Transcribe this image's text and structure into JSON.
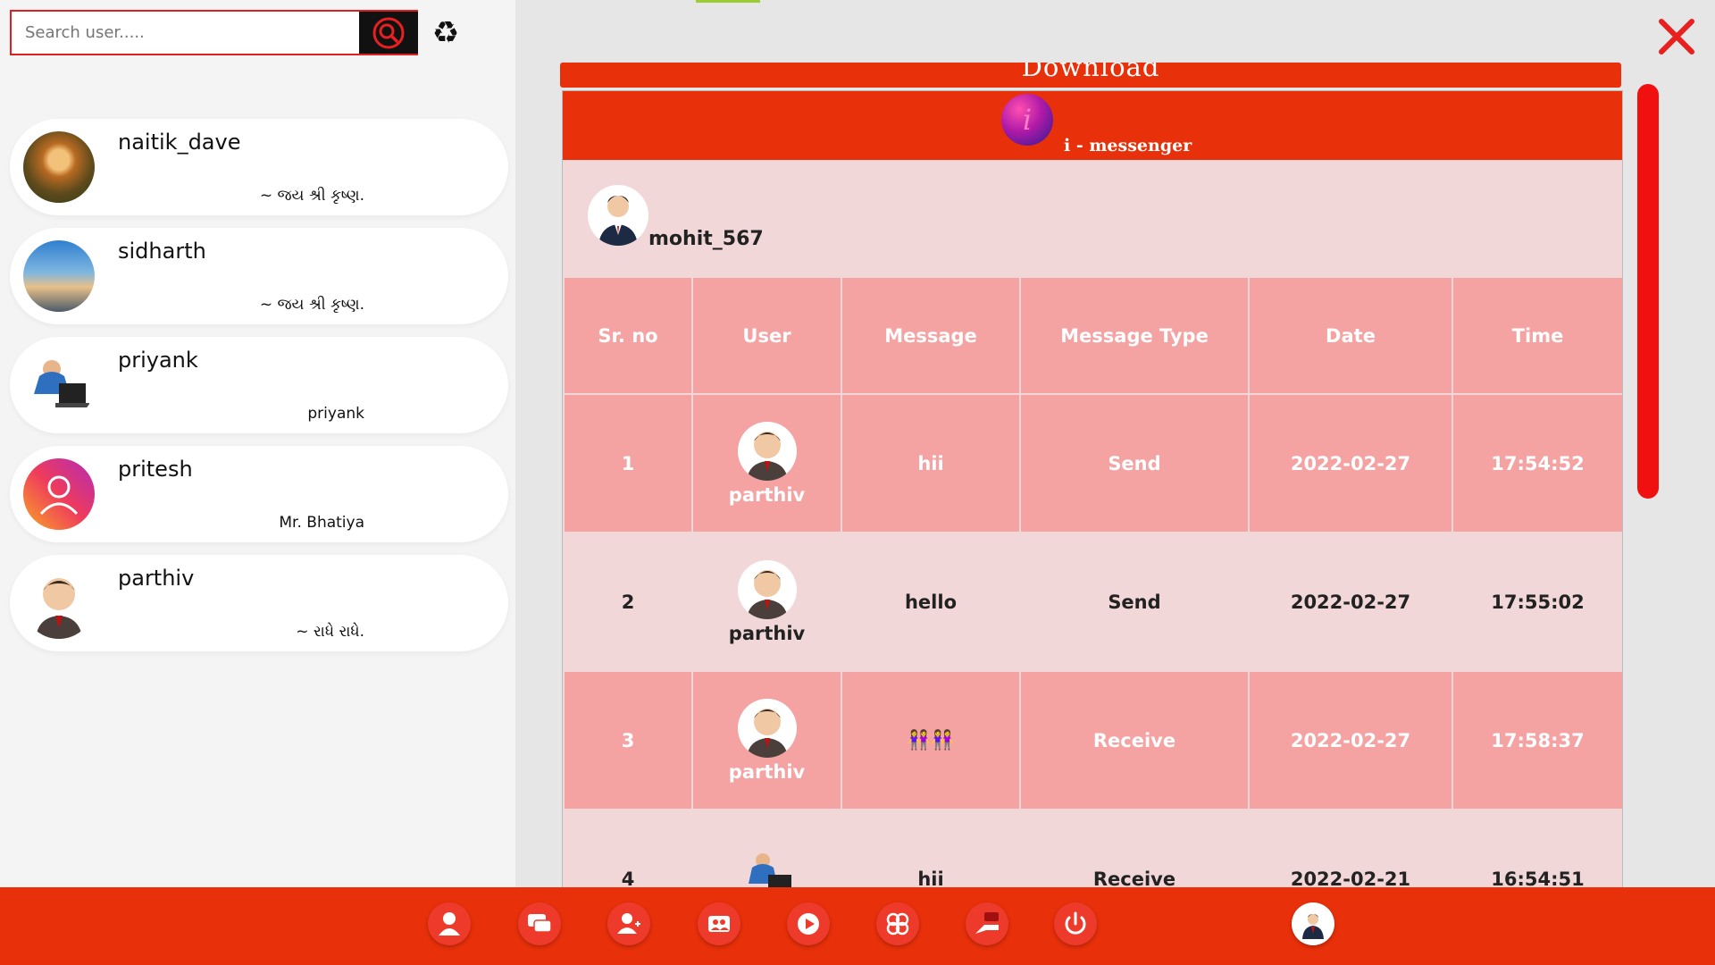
{
  "search": {
    "placeholder": "Search user....."
  },
  "contacts": [
    {
      "name": "naitik_dave",
      "status": "~ જય શ્રી કૃષ્ણ."
    },
    {
      "name": "sidharth",
      "status": "~ જય શ્રી કૃષ્ણ."
    },
    {
      "name": "priyank",
      "status": "priyank"
    },
    {
      "name": "pritesh",
      "status": "Mr. Bhatiya"
    },
    {
      "name": "parthiv",
      "status": "~ રાધે રાધે."
    }
  ],
  "download": {
    "label": "Download"
  },
  "document": {
    "app_title": "i - messenger",
    "logo_letter": "i",
    "owner": "mohit_567",
    "columns": [
      "Sr. no",
      "User",
      "Message",
      "Message Type",
      "Date",
      "Time"
    ],
    "rows": [
      {
        "sr": "1",
        "user": "parthiv",
        "message": "hii",
        "type": "Send",
        "date": "2022-02-27",
        "time": "17:54:52"
      },
      {
        "sr": "2",
        "user": "parthiv",
        "message": "hello",
        "type": "Send",
        "date": "2022-02-27",
        "time": "17:55:02"
      },
      {
        "sr": "3",
        "user": "parthiv",
        "message": "👭👭",
        "type": "Receive",
        "date": "2022-02-27",
        "time": "17:58:37"
      },
      {
        "sr": "4",
        "user": "",
        "message": "hii",
        "type": "Receive",
        "date": "2022-02-21",
        "time": "16:54:51"
      }
    ]
  },
  "colors": {
    "accent": "#e8300a",
    "row_dark": "#f5a2a2",
    "row_light": "#f2d7d9",
    "close": "#e82020"
  },
  "taskbar_icons": [
    "profile-icon",
    "chat-icon",
    "add-user-icon",
    "group-icon",
    "media-icon",
    "settings-icon",
    "feedback-icon",
    "power-icon",
    "user-avatar-icon"
  ]
}
